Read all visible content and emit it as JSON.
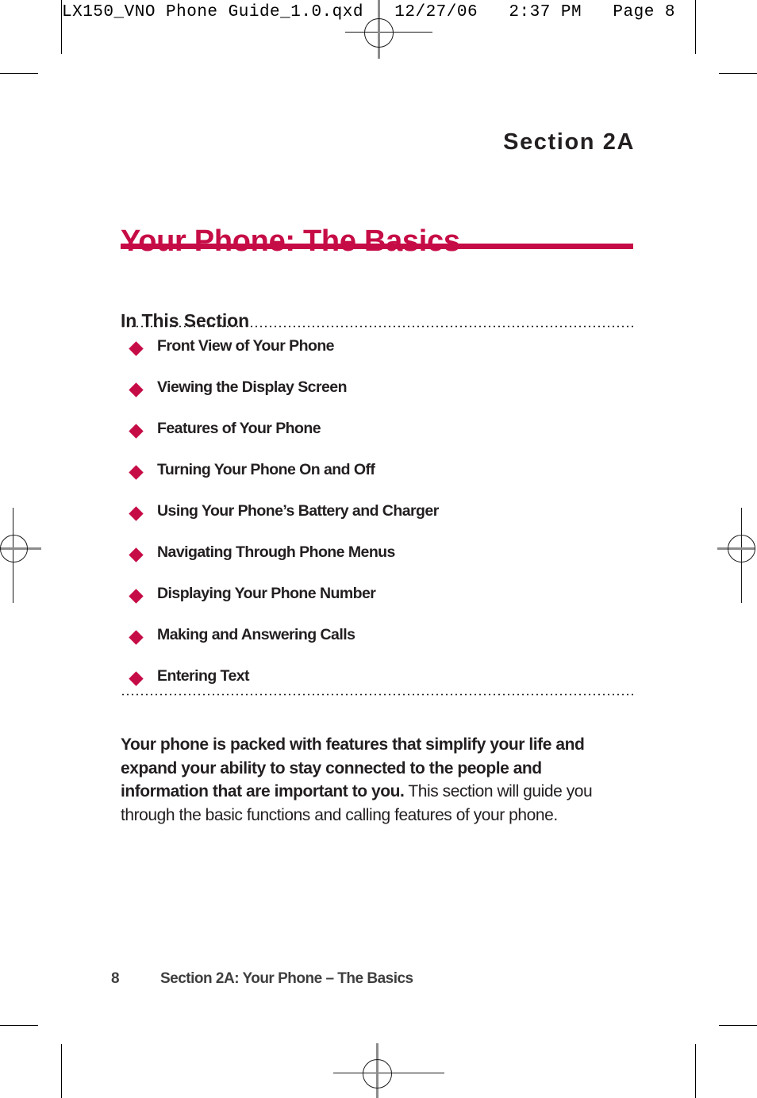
{
  "proof_header": {
    "text": "LX150_VNO Phone Guide_1.0.qxd   12/27/06   2:37 PM   Page 8"
  },
  "colors": {
    "accent": "#c60c46",
    "text": "#231f20",
    "footer_text": "#3f3f3f"
  },
  "section": {
    "eyebrow": "Section 2A",
    "title": "Your Phone: The Basics"
  },
  "in_this_section": {
    "heading": "In This Section",
    "items": [
      {
        "label": "Front View of Your Phone"
      },
      {
        "label": "Viewing the Display Screen"
      },
      {
        "label": "Features of Your Phone"
      },
      {
        "label": "Turning Your Phone On and Off"
      },
      {
        "label": "Using Your Phone’s Battery and Charger"
      },
      {
        "label": "Navigating Through Phone Menus"
      },
      {
        "label": "Displaying Your Phone Number"
      },
      {
        "label": "Making and Answering Calls"
      },
      {
        "label": "Entering Text"
      }
    ]
  },
  "intro": {
    "lead": "Your phone is packed with features that simplify your life and expand your ability to stay connected to the people and information that are important to you.",
    "rest": " This section will guide you through the basic functions and calling features of your phone."
  },
  "footer": {
    "page_number": "8",
    "label": "Section 2A: Your Phone – The Basics"
  }
}
